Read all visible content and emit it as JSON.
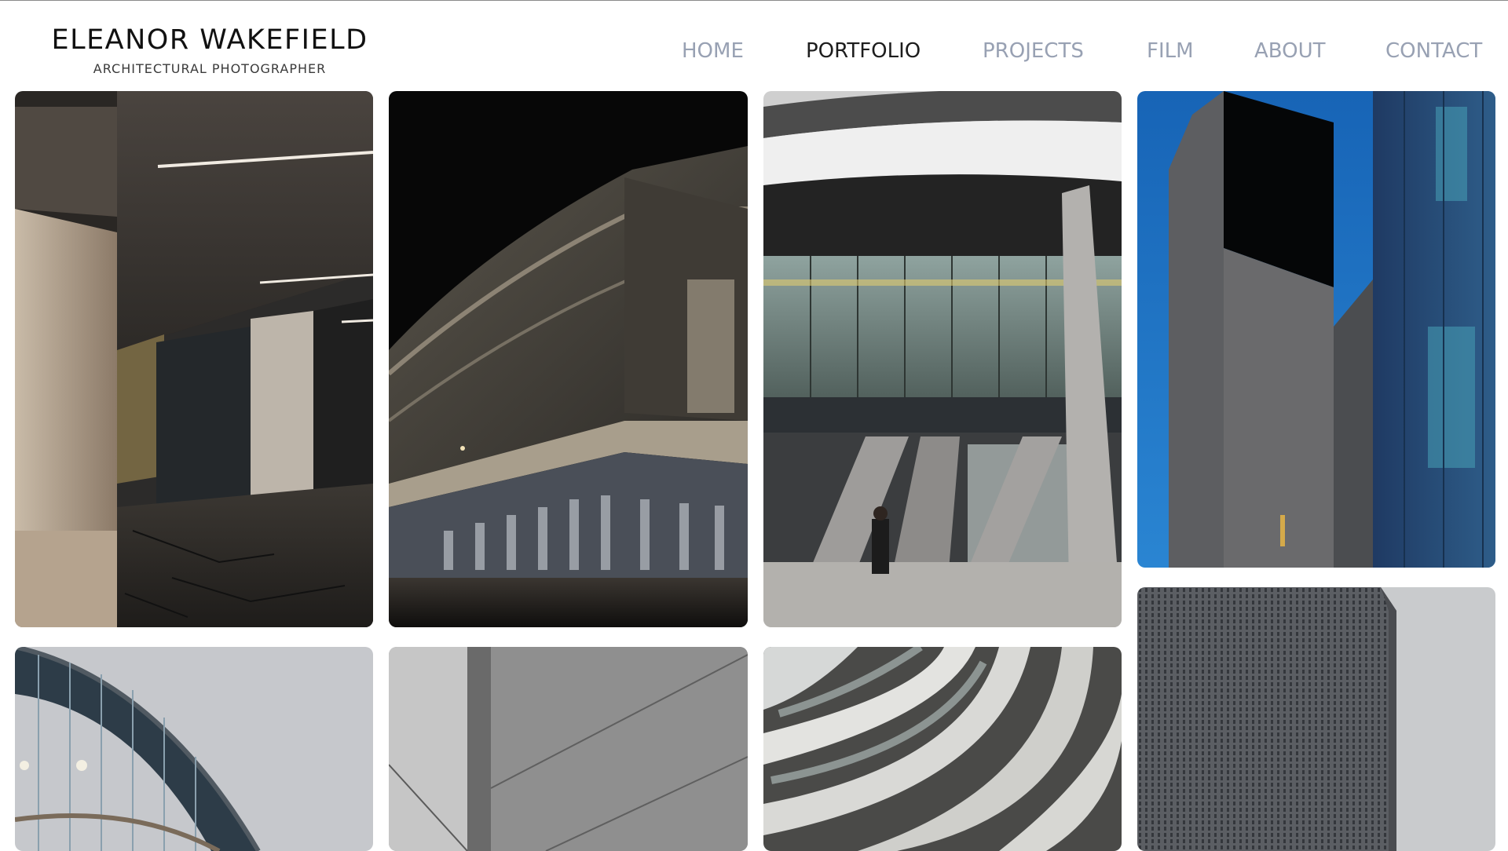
{
  "site": {
    "name": "ELEANOR WAKEFIELD",
    "tagline": "ARCHITECTURAL PHOTOGRAPHER"
  },
  "nav": {
    "items": [
      {
        "label": "HOME",
        "active": false
      },
      {
        "label": "PORTFOLIO",
        "active": true
      },
      {
        "label": "PROJECTS",
        "active": false
      },
      {
        "label": "FILM",
        "active": false
      },
      {
        "label": "ABOUT",
        "active": false
      },
      {
        "label": "CONTACT",
        "active": false
      }
    ]
  },
  "colors": {
    "nav_active": "#1d1d1d",
    "nav_inactive": "#98a1b3",
    "brand_text": "#111111"
  },
  "gallery": {
    "photos": [
      {
        "subject": "concrete-underpass-photo"
      },
      {
        "subject": "curved-glass-building-night-photo"
      },
      {
        "subject": "glass-facade-pillars-photo"
      },
      {
        "subject": "blue-facade-photo"
      },
      {
        "subject": "curved-glass-roof-photo"
      },
      {
        "subject": "concrete-wall-detail-photo"
      },
      {
        "subject": "curved-balconies-photo"
      },
      {
        "subject": "perforated-tower-photo"
      }
    ]
  }
}
